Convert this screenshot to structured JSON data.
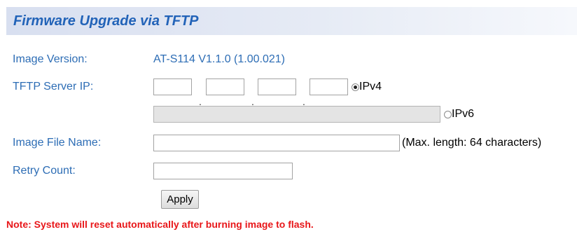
{
  "header": {
    "title": "Firmware Upgrade via TFTP"
  },
  "form": {
    "image_version": {
      "label": "Image Version:",
      "value": "AT-S114 V1.1.0 (1.00.021)"
    },
    "tftp_server_ip": {
      "label": "TFTP Server IP:",
      "octets": [
        "",
        "",
        "",
        ""
      ],
      "separator": ".",
      "ipv4": {
        "label": "IPv4",
        "selected": true
      },
      "ipv6": {
        "label": "IPv6",
        "selected": false,
        "value": ""
      }
    },
    "image_file_name": {
      "label": "Image File Name:",
      "value": "",
      "hint": "(Max. length: 64 characters)"
    },
    "retry_count": {
      "label": "Retry Count:",
      "value": ""
    },
    "apply_label": "Apply"
  },
  "note": "Note: System will reset automatically after burning image to flash."
}
